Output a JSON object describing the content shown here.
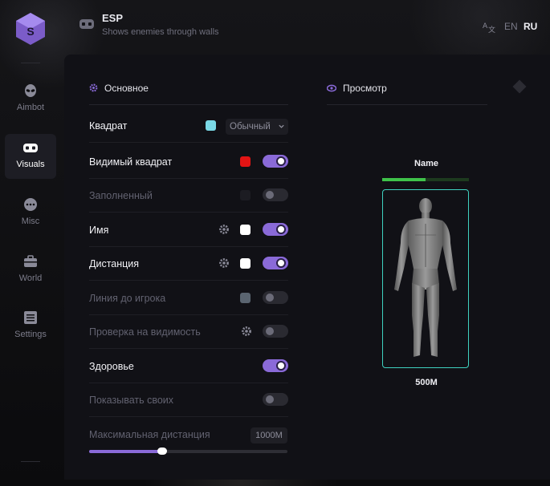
{
  "header": {
    "feature_title": "ESP",
    "feature_subtitle": "Shows enemies through walls",
    "languages": [
      "EN",
      "RU"
    ],
    "active_language": "RU"
  },
  "sidebar": {
    "items": [
      {
        "label": "Aimbot",
        "icon": "alien-icon",
        "active": false
      },
      {
        "label": "Visuals",
        "icon": "vr-goggles-icon",
        "active": true
      },
      {
        "label": "Misc",
        "icon": "chat-dots-icon",
        "active": false
      },
      {
        "label": "World",
        "icon": "briefcase-icon",
        "active": false
      },
      {
        "label": "Settings",
        "icon": "list-icon",
        "active": false
      }
    ]
  },
  "main": {
    "section_title": "Основное",
    "rows": [
      {
        "label": "Квадрат",
        "enabled": true,
        "swatch": "#7ad9e6",
        "select": "Обычный"
      },
      {
        "label": "Видимый квадрат",
        "enabled": true,
        "swatch": "#e31414",
        "toggle": true
      },
      {
        "label": "Заполненный",
        "enabled": false,
        "swatch": "#1c1c22",
        "toggle": false
      },
      {
        "label": "Имя",
        "enabled": true,
        "gear": true,
        "swatch": "#ffffff",
        "toggle": true
      },
      {
        "label": "Дистанция",
        "enabled": true,
        "gear": true,
        "swatch": "#ffffff",
        "toggle": true
      },
      {
        "label": "Линия до игрока",
        "enabled": false,
        "swatch": "#5a6470",
        "toggle": false
      },
      {
        "label": "Проверка на видимость",
        "enabled": false,
        "gear": true,
        "toggle": false
      },
      {
        "label": "Здоровье",
        "enabled": true,
        "toggle": true
      },
      {
        "label": "Показывать своих",
        "enabled": false,
        "toggle": false
      }
    ],
    "max_distance": {
      "label": "Максимальная дистанция",
      "value": "1000M",
      "fraction": 0.37
    }
  },
  "preview": {
    "title": "Просмотр",
    "player_name": "Name",
    "health_fraction": 0.5,
    "distance": "500M"
  },
  "colors": {
    "accent": "#8a6ad8",
    "box": "#3fd2c0",
    "health": "#3fc34a"
  }
}
